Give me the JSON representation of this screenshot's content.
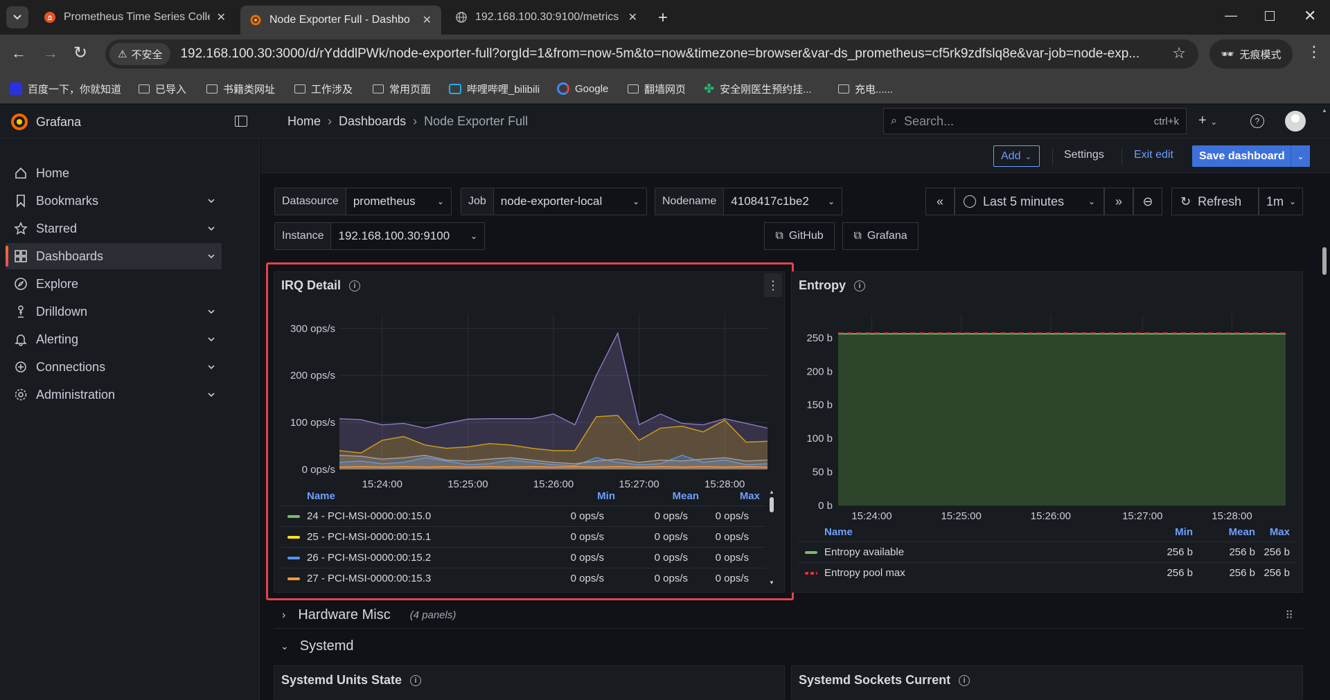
{
  "browser": {
    "tabs": [
      {
        "title": "Prometheus Time Series Colle",
        "active": false
      },
      {
        "title": "Node Exporter Full - Dashbo",
        "active": true
      },
      {
        "title": "192.168.100.30:9100/metrics",
        "active": false
      }
    ],
    "security_label": "不安全",
    "url": "192.168.100.30:3000/d/rYdddlPWk/node-exporter-full?orgId=1&from=now-5m&to=now&timezone=browser&var-ds_prometheus=cf5rk9zdfslq8e&var-job=node-exp...",
    "profile_label": "无痕模式",
    "bookmarks": [
      "百度一下，你就知道",
      "已导入",
      "书籍类网址",
      "工作涉及",
      "常用页面",
      "哔哩哔哩_bilibili",
      "Google",
      "翻墙网页",
      "安全刚医生预约挂...",
      "充电......"
    ]
  },
  "grafana": {
    "brand": "Grafana",
    "breadcrumb": [
      "Home",
      "Dashboards",
      "Node Exporter Full"
    ],
    "search_placeholder": "Search...",
    "search_shortcut": "ctrl+k",
    "nav": [
      {
        "label": "Home",
        "icon": "home-icon",
        "chev": false
      },
      {
        "label": "Bookmarks",
        "icon": "bookmark-icon",
        "chev": true
      },
      {
        "label": "Starred",
        "icon": "star-icon",
        "chev": true
      },
      {
        "label": "Dashboards",
        "icon": "dashboards-icon",
        "chev": true,
        "active": true
      },
      {
        "label": "Explore",
        "icon": "compass-icon",
        "chev": false
      },
      {
        "label": "Drilldown",
        "icon": "drilldown-icon",
        "chev": true
      },
      {
        "label": "Alerting",
        "icon": "bell-icon",
        "chev": true
      },
      {
        "label": "Connections",
        "icon": "connections-icon",
        "chev": true
      },
      {
        "label": "Administration",
        "icon": "cog-icon",
        "chev": true
      }
    ],
    "toolbar": {
      "add": "Add",
      "settings": "Settings",
      "exit_edit": "Exit edit",
      "save": "Save dashboard"
    },
    "variables": {
      "datasource": {
        "label": "Datasource",
        "value": "prometheus"
      },
      "job": {
        "label": "Job",
        "value": "node-exporter-local"
      },
      "nodename": {
        "label": "Nodename",
        "value": "4108417c1be2"
      },
      "instance": {
        "label": "Instance",
        "value": "192.168.100.30:9100"
      }
    },
    "time_range": "Last 5 minutes",
    "refresh": "Refresh",
    "refresh_interval": "1m",
    "links": [
      "GitHub",
      "Grafana"
    ],
    "rows": {
      "hardware_misc": {
        "title": "Hardware Misc",
        "count": "(4 panels)"
      },
      "systemd": {
        "title": "Systemd"
      }
    },
    "bottom_panels": [
      "Systemd Units State",
      "Systemd Sockets Current"
    ]
  },
  "irq_panel": {
    "title": "IRQ Detail",
    "legend_headers": {
      "name": "Name",
      "min": "Min",
      "mean": "Mean",
      "max": "Max"
    },
    "legend": [
      {
        "name": "24 - PCI-MSI-0000:00:15.0",
        "color": "#73bf69",
        "min": "0 ops/s",
        "mean": "0 ops/s",
        "max": "0 ops/s"
      },
      {
        "name": "25 - PCI-MSI-0000:00:15.1",
        "color": "#fade2a",
        "min": "0 ops/s",
        "mean": "0 ops/s",
        "max": "0 ops/s"
      },
      {
        "name": "26 - PCI-MSI-0000:00:15.2",
        "color": "#5794f2",
        "min": "0 ops/s",
        "mean": "0 ops/s",
        "max": "0 ops/s"
      },
      {
        "name": "27 - PCI-MSI-0000:00:15.3",
        "color": "#ff9830",
        "min": "0 ops/s",
        "mean": "0 ops/s",
        "max": "0 ops/s"
      }
    ]
  },
  "entropy_panel": {
    "title": "Entropy",
    "legend_headers": {
      "name": "Name",
      "min": "Min",
      "mean": "Mean",
      "max": "Max"
    },
    "legend": [
      {
        "name": "Entropy available",
        "color": "#73bf69",
        "min": "256 b",
        "mean": "256 b",
        "max": "256 b"
      },
      {
        "name": "Entropy pool max",
        "color": "#e02f44",
        "min": "256 b",
        "mean": "256 b",
        "max": "256 b"
      }
    ]
  },
  "chart_data": [
    {
      "type": "area",
      "title": "IRQ Detail",
      "x": [
        "15:23:30",
        "15:23:45",
        "15:24:00",
        "15:24:15",
        "15:24:30",
        "15:24:45",
        "15:25:00",
        "15:25:15",
        "15:25:30",
        "15:25:45",
        "15:26:00",
        "15:26:15",
        "15:26:30",
        "15:26:45",
        "15:27:00",
        "15:27:15",
        "15:27:30",
        "15:27:45",
        "15:28:00",
        "15:28:15",
        "15:28:30"
      ],
      "x_ticks": [
        "15:24:00",
        "15:25:00",
        "15:26:00",
        "15:27:00",
        "15:28:00"
      ],
      "y_ticks": [
        "0 ops/s",
        "100 ops/s",
        "200 ops/s",
        "300 ops/s"
      ],
      "ylim": [
        0,
        330
      ],
      "series": [
        {
          "color": "#8f7ac8",
          "values": [
            108,
            106,
            95,
            98,
            88,
            98,
            107,
            108,
            108,
            108,
            118,
            95,
            200,
            290,
            95,
            118,
            98,
            95,
            108,
            98,
            88
          ]
        },
        {
          "color": "#d4a017",
          "values": [
            40,
            35,
            62,
            70,
            52,
            45,
            48,
            55,
            52,
            45,
            40,
            40,
            112,
            115,
            62,
            88,
            92,
            80,
            105,
            58,
            60
          ]
        },
        {
          "color": "#5794f2",
          "values": [
            15,
            18,
            12,
            15,
            25,
            18,
            10,
            12,
            20,
            15,
            10,
            8,
            25,
            15,
            10,
            12,
            30,
            15,
            20,
            10,
            12
          ]
        },
        {
          "color": "#a0a0a0",
          "values": [
            30,
            28,
            22,
            25,
            30,
            20,
            18,
            22,
            25,
            20,
            15,
            12,
            18,
            22,
            15,
            20,
            18,
            22,
            25,
            18,
            20
          ]
        },
        {
          "color": "#ff9830",
          "values": [
            5,
            6,
            5,
            6,
            5,
            6,
            5,
            6,
            5,
            6,
            5,
            6,
            5,
            6,
            5,
            6,
            5,
            6,
            5,
            6,
            5
          ]
        }
      ]
    },
    {
      "type": "area",
      "title": "Entropy",
      "x_ticks": [
        "15:24:00",
        "15:25:00",
        "15:26:00",
        "15:27:00",
        "15:28:00"
      ],
      "y_ticks": [
        "0 b",
        "50 b",
        "100 b",
        "150 b",
        "200 b",
        "250 b"
      ],
      "ylim": [
        0,
        285
      ],
      "series": [
        {
          "name": "Entropy available",
          "values": [
            256,
            256,
            256,
            256,
            256,
            256,
            256,
            256,
            256,
            256,
            256
          ],
          "color": "#73bf69"
        },
        {
          "name": "Entropy pool max",
          "values": [
            256,
            256,
            256,
            256,
            256,
            256,
            256,
            256,
            256,
            256,
            256
          ],
          "color": "#e02f44"
        }
      ]
    }
  ]
}
